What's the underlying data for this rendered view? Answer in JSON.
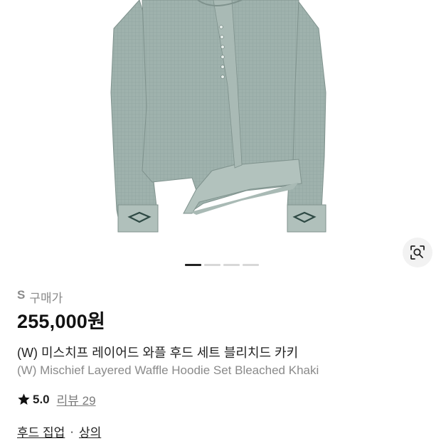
{
  "gallery": {
    "image_alt": "(W) Mischief Layered Waffle Hoodie Set Bleached Khaki",
    "slide_count": 4,
    "active_slide": 1
  },
  "product": {
    "size_label": "S",
    "purchase_label": "구매가",
    "price": "255,000원",
    "title_ko": "(W) 미스치프 레이어드 와플 후드 세트 블리치드 카키",
    "title_en": "(W) Mischief Layered Waffle Hoodie Set Bleached Khaki"
  },
  "rating": {
    "score": "5.0",
    "review_label": "리뷰 29"
  },
  "categories": {
    "primary": "후드 집업",
    "separator": "·",
    "secondary": "상의"
  },
  "icons": {
    "lens": "image-search-icon",
    "star": "star-icon"
  },
  "colors": {
    "garment": "#9fb2ad",
    "garment_shade": "#8a9e99",
    "garment_light": "#b6c6c1",
    "text_primary": "#222222",
    "text_secondary": "#8a8a8a",
    "indicator_active": "#222222",
    "indicator_inactive": "#d8d8d8"
  }
}
